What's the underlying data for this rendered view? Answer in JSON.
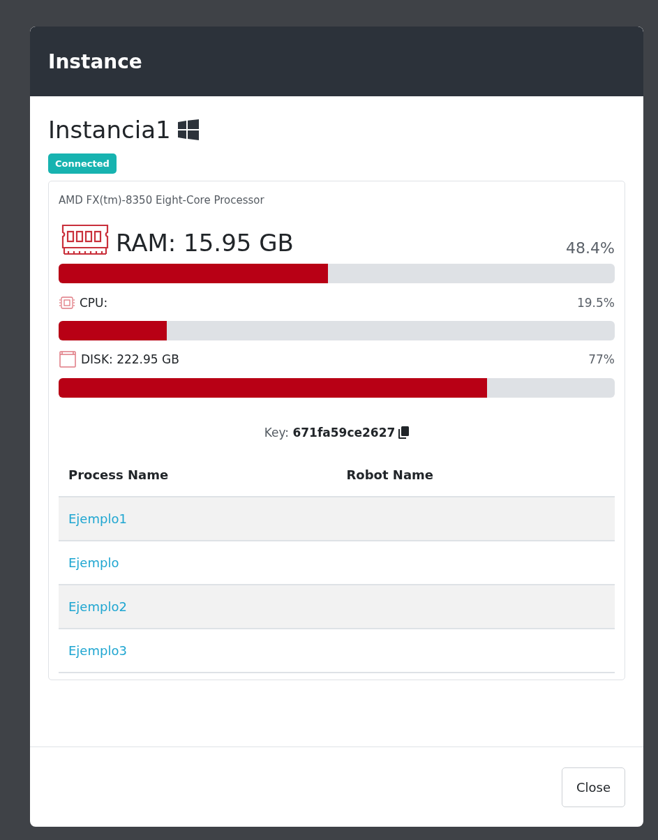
{
  "modal": {
    "title": "Instance"
  },
  "instance": {
    "name": "Instancia1",
    "status": "Connected",
    "processor": "AMD FX(tm)-8350 Eight-Core Processor"
  },
  "metrics": [
    {
      "kind": "ram",
      "label": "RAM: 15.95 GB",
      "reading": "48.4%",
      "level": 0.484
    },
    {
      "kind": "cpu",
      "label": "CPU:",
      "reading": "19.5%",
      "level": 0.195
    },
    {
      "kind": "disk",
      "label": "DISK: 222.95 GB",
      "reading": "77%",
      "level": 0.77
    }
  ],
  "key": "Key: **671fa59ce2627**",
  "table": {
    "columns": [
      "Process Name",
      "Robot Name"
    ],
    "rows": [
      {
        "process": "Ejemplo1"
      },
      {
        "process": "Ejemplo"
      },
      {
        "process": "Ejemplo2"
      },
      {
        "process": "Ejemplo3"
      }
    ]
  },
  "buttons": [
    "Close"
  ]
}
